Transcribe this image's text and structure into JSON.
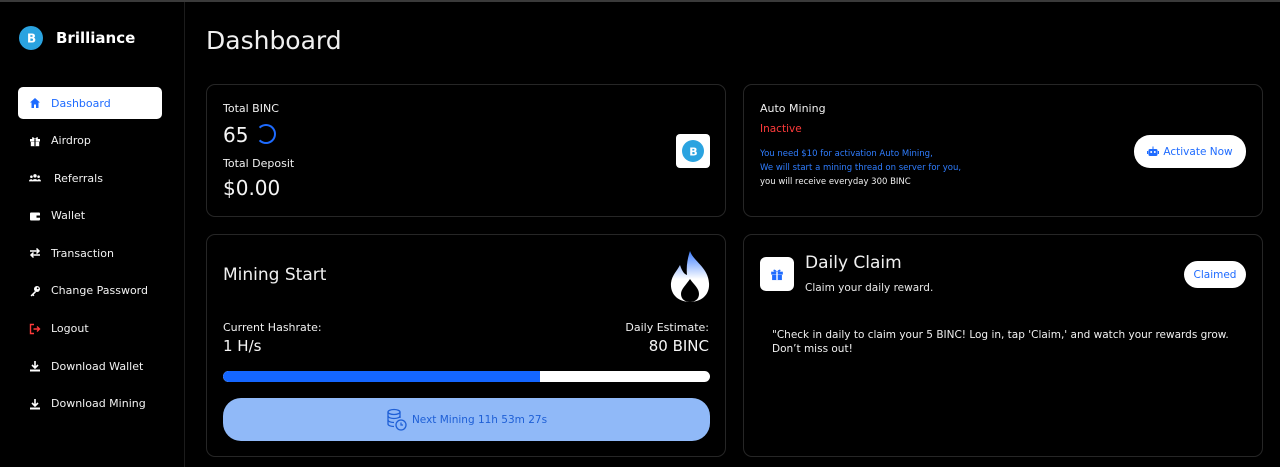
{
  "brand": {
    "name": "Brilliance",
    "logo_icon": "brilliance-logo-icon",
    "color": "#2aa3e0"
  },
  "sidebar": {
    "items": [
      {
        "label": "Dashboard",
        "icon": "home-icon",
        "active": true
      },
      {
        "label": "Airdrop",
        "icon": "gift-icon"
      },
      {
        "label": "Referrals",
        "icon": "users-icon"
      },
      {
        "label": "Wallet",
        "icon": "wallet-icon"
      },
      {
        "label": "Transaction",
        "icon": "arrows-exchange-icon"
      },
      {
        "label": "Change Password",
        "icon": "key-icon"
      },
      {
        "label": "Logout",
        "icon": "logout-icon"
      },
      {
        "label": "Download Wallet",
        "icon": "download-icon"
      },
      {
        "label": "Download Mining",
        "icon": "download-icon"
      }
    ]
  },
  "page": {
    "title": "Dashboard"
  },
  "balance": {
    "total_label": "Total BINC",
    "total_value": "65",
    "deposit_label": "Total Deposit",
    "deposit_value": "$0.00"
  },
  "auto_mining": {
    "title": "Auto Mining",
    "status": "Inactive",
    "line1": "You need $10 for activation Auto Mining,",
    "line2": "We will start a mining thread on server for you,",
    "line3": "you will receive everyday 300 BINC",
    "button_label": "Activate Now",
    "button_icon": "robot-icon"
  },
  "mining": {
    "title": "Mining Start",
    "hashrate_label": "Current Hashrate:",
    "hashrate_value": "1 H/s",
    "estimate_label": "Daily Estimate:",
    "estimate_value": "80 BINC",
    "progress_fraction": 0.65,
    "next_label": "Next Mining 11h 53m 27s",
    "flame_icon": "flame-icon",
    "coins_icon": "coins-clock-icon"
  },
  "daily_claim": {
    "title": "Daily Claim",
    "subtitle": "Claim your daily reward.",
    "button_label": "Claimed",
    "message": "\"Check in daily to claim your 5 BINC! Log in, tap 'Claim,' and watch your rewards grow. Don’t miss out!"
  },
  "colors": {
    "accent": "#1e6bff",
    "danger": "#ff3b3b",
    "info_blue": "#2f7dff",
    "progress_fill": "#1466ff",
    "mining_button_bg": "#90b9f8"
  }
}
